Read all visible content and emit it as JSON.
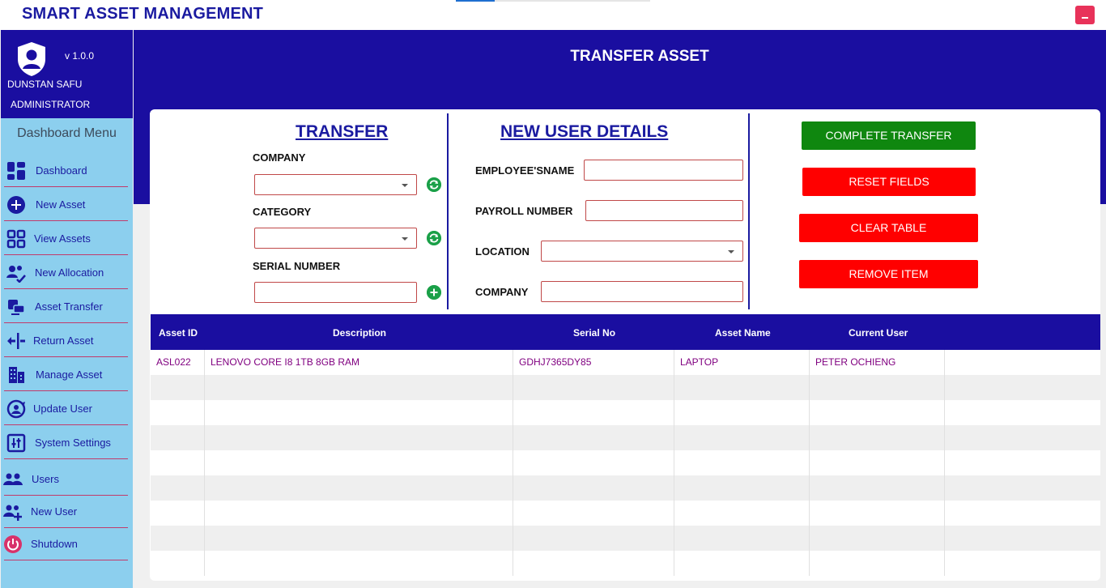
{
  "app": {
    "title": "SMART ASSET MANAGEMENT"
  },
  "colors": {
    "brand": "#1a0ea0",
    "sidebar": "#8ccfee",
    "success": "#0f870f",
    "danger": "#ff0000",
    "minimize": "#e8325a"
  },
  "profile": {
    "version": "v 1.0.0",
    "name": "DUNSTAN SAFU",
    "role": "ADMINISTRATOR",
    "avatar_icon": "user-shield-icon"
  },
  "sidebar": {
    "title": "Dashboard Menu",
    "items": [
      {
        "label": "Dashboard",
        "icon": "dashboard-icon"
      },
      {
        "label": "New Asset",
        "icon": "add-circle-icon"
      },
      {
        "label": "View Assets",
        "icon": "grid-icon"
      },
      {
        "label": "New Allocation",
        "icon": "user-check-icon"
      },
      {
        "label": "Asset Transfer",
        "icon": "transfer-icon"
      },
      {
        "label": "Return Asset",
        "icon": "return-icon"
      },
      {
        "label": "Manage Asset",
        "icon": "building-icon"
      },
      {
        "label": "Update User",
        "icon": "user-sync-icon"
      },
      {
        "label": "System Settings",
        "icon": "settings-icon"
      },
      {
        "label": "Users",
        "icon": "users-icon"
      },
      {
        "label": "New User",
        "icon": "user-add-icon"
      },
      {
        "label": "Shutdown",
        "icon": "power-icon"
      }
    ]
  },
  "page": {
    "title": "TRANSFER ASSET"
  },
  "transfer": {
    "title": "TRANSFER",
    "company_label": "COMPANY",
    "category_label": "CATEGORY",
    "serial_label": "SERIAL NUMBER",
    "company_value": "",
    "category_value": "",
    "serial_value": ""
  },
  "new_user": {
    "title": "NEW USER DETAILS",
    "employee_label": "EMPLOYEE'SNAME",
    "payroll_label": "PAYROLL NUMBER",
    "location_label": "LOCATION",
    "company_label": "COMPANY",
    "employee_value": "",
    "payroll_value": "",
    "location_value": "",
    "company_value": ""
  },
  "actions": {
    "complete": "COMPLETE TRANSFER",
    "reset": "RESET FIELDS",
    "clear": "CLEAR TABLE",
    "remove": "REMOVE ITEM"
  },
  "table": {
    "columns": [
      "Asset ID",
      "Description",
      "Serial No",
      "Asset Name",
      "Current User"
    ],
    "rows": [
      [
        "ASL022",
        "LENOVO CORE I8 1TB 8GB RAM",
        "GDHJ7365DY85",
        "LAPTOP",
        "PETER OCHIENG"
      ]
    ]
  }
}
